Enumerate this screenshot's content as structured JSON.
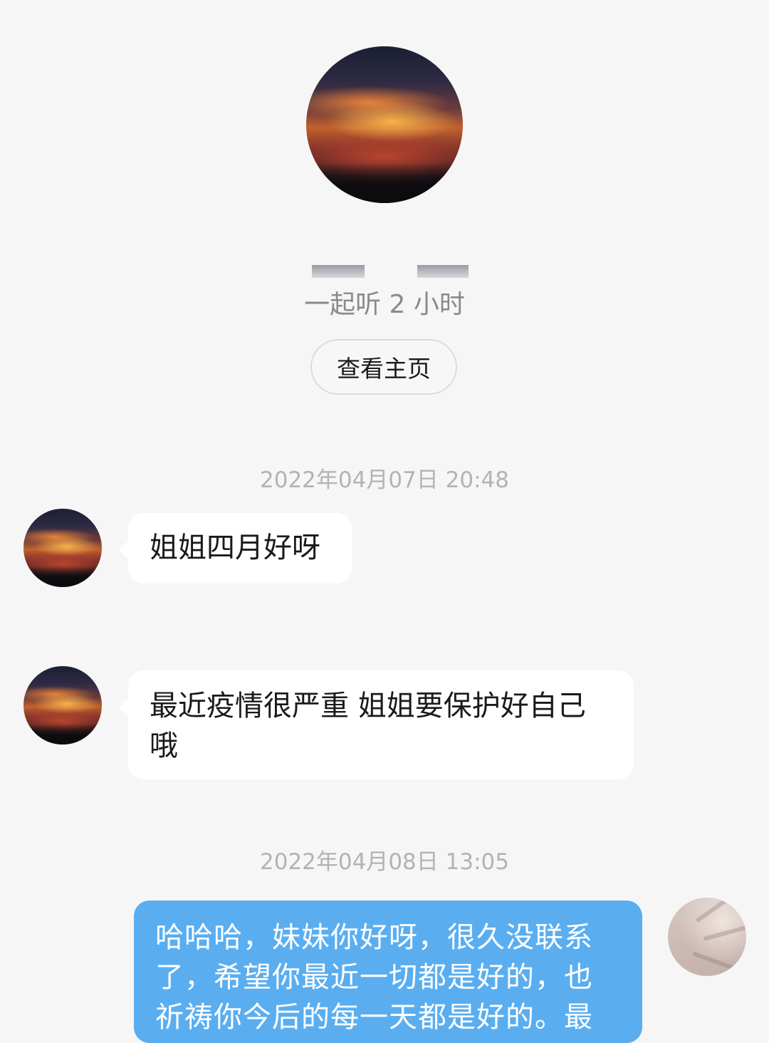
{
  "profile": {
    "avatar_icon": "sunset-avatar-icon",
    "listen_time": "一起听 2 小时",
    "view_home_label": "查看主页"
  },
  "messages": [
    {
      "timestamp": "2022年04月07日 20:48",
      "sender": "other",
      "text": "姐姐四月好呀"
    },
    {
      "sender": "other",
      "text": "最近疫情很严重 姐姐要保护好自己哦"
    },
    {
      "timestamp": "2022年04月08日 13:05",
      "sender": "me",
      "text": "哈哈哈，妹妹你好呀，很久没联系了，希望你最近一切都是好的，也祈祷你今后的每一天都是好的。最"
    }
  ],
  "colors": {
    "background": "#f6f6f6",
    "bubble_other": "#ffffff",
    "bubble_me": "#5aaef0",
    "timestamp": "#b3b3b3"
  }
}
